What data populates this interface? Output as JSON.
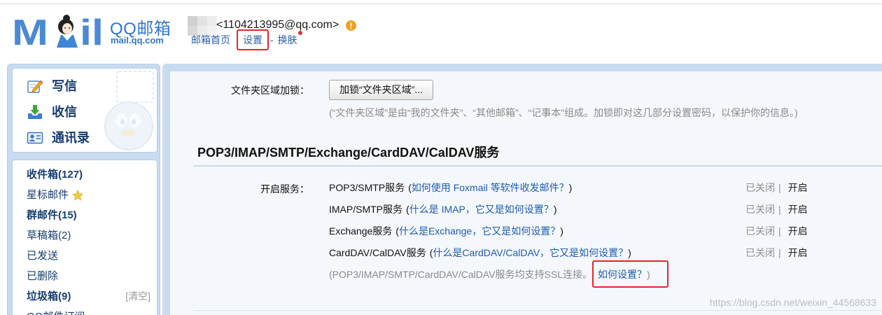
{
  "logo": {
    "first": "M",
    "rest": "il",
    "brand": "QQ邮箱",
    "domain": "mail.qq.com"
  },
  "account": {
    "email": "<1104213995@qq.com>",
    "warning_icon": "warning-icon"
  },
  "topnav": {
    "home": "邮箱首页",
    "settings": "设置",
    "separator": "-",
    "skin": "换肤"
  },
  "sidebar": {
    "actions": [
      {
        "label": "写信",
        "icon": "compose-icon"
      },
      {
        "label": "收信",
        "icon": "receive-mail-icon"
      },
      {
        "label": "通讯录",
        "icon": "contacts-icon"
      }
    ],
    "folders": [
      {
        "label": "收件箱(127)",
        "bold": true
      },
      {
        "label": "星标邮件",
        "icon": "star-icon"
      },
      {
        "label": "群邮件(15)",
        "bold": true
      },
      {
        "label": "草稿箱(2)"
      },
      {
        "label": "已发送"
      },
      {
        "label": "已删除"
      },
      {
        "label": "垃圾箱(9)",
        "bold": true,
        "action": "[清空]"
      },
      {
        "label": "QQ邮件订阅"
      }
    ]
  },
  "settings": {
    "folder_lock": {
      "label": "文件夹区域加锁：",
      "button": "加锁“文件夹区域”...",
      "hint": "(“文件夹区域”是由“我的文件夹”、“其他邮箱”、“记事本”组成。加锁即对这几部分设置密码，以保护你的信息。)"
    },
    "section_title": "POP3/IMAP/SMTP/Exchange/CardDAV/CalDAV服务",
    "services_label": "开启服务：",
    "paren_open": "(",
    "paren_close": ")",
    "status_divider": "|",
    "services": [
      {
        "name": "POP3/SMTP服务",
        "help": "如何使用 Foxmail 等软件收发邮件？",
        "status": "已关闭",
        "action": "开启"
      },
      {
        "name": "IMAP/SMTP服务",
        "help": "什么是 IMAP，它又是如何设置？",
        "status": "已关闭",
        "action": "开启"
      },
      {
        "name": "Exchange服务",
        "help": "什么是Exchange，它又是如何设置？",
        "status": "已关闭",
        "action": "开启"
      },
      {
        "name": "CardDAV/CalDAV服务",
        "help": "什么是CardDAV/CalDAV，它又是如何设置？",
        "status": "已关闭",
        "action": "开启"
      }
    ],
    "ssl_note": {
      "text": "(POP3/IMAP/SMTP/CardDAV/CalDAV服务均支持SSL连接。",
      "link": "如何设置？",
      "close": ")"
    }
  },
  "watermark": "https://blog.csdn.net/weixin_44568633",
  "colors": {
    "brand_blue": "#2e78cf",
    "link": "#1e5bb0",
    "nav": "#2d5fa6",
    "sidebar_text": "#173d70",
    "muted": "#8a8a8a",
    "panel": "#c8dbf0",
    "highlight": "#e3262b",
    "warning": "#f0a020"
  }
}
